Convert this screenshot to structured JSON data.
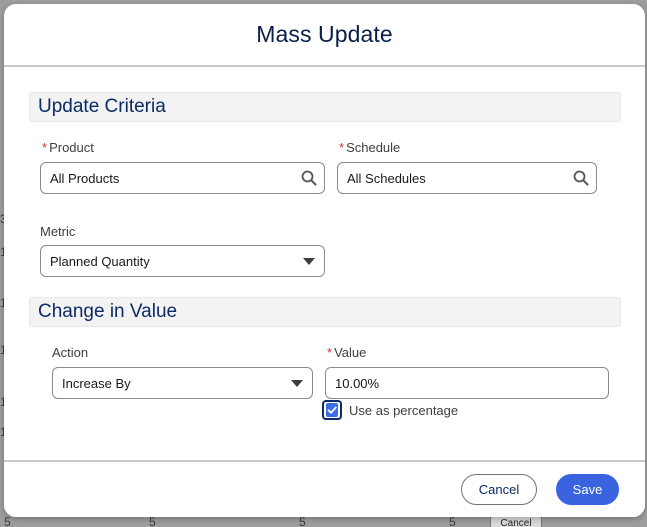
{
  "backdrop": {
    "cells": [
      "3",
      "1",
      "1",
      "1",
      "1",
      "1",
      "5",
      "5",
      "5",
      "5"
    ],
    "button_label": "Cancel"
  },
  "modal": {
    "title": "Mass Update",
    "sections": {
      "criteria": {
        "title": "Update Criteria",
        "product": {
          "label": "Product",
          "required": "*",
          "value": "All Products"
        },
        "schedule": {
          "label": "Schedule",
          "required": "*",
          "value": "All Schedules"
        },
        "metric": {
          "label": "Metric",
          "value": "Planned Quantity"
        }
      },
      "change": {
        "title": "Change in Value",
        "action": {
          "label": "Action",
          "value": "Increase By"
        },
        "value": {
          "label": "Value",
          "required": "*",
          "value": "10.00%"
        },
        "use_percentage": {
          "label": "Use as percentage",
          "checked": true
        }
      }
    },
    "footer": {
      "cancel_label": "Cancel",
      "save_label": "Save"
    }
  },
  "colors": {
    "accent": "#3a63e0",
    "title": "#0b1e4a",
    "section_title": "#0b2a66",
    "required": "#c23934"
  },
  "icons": [
    "search-icon",
    "chevron-down-icon",
    "check-icon"
  ]
}
